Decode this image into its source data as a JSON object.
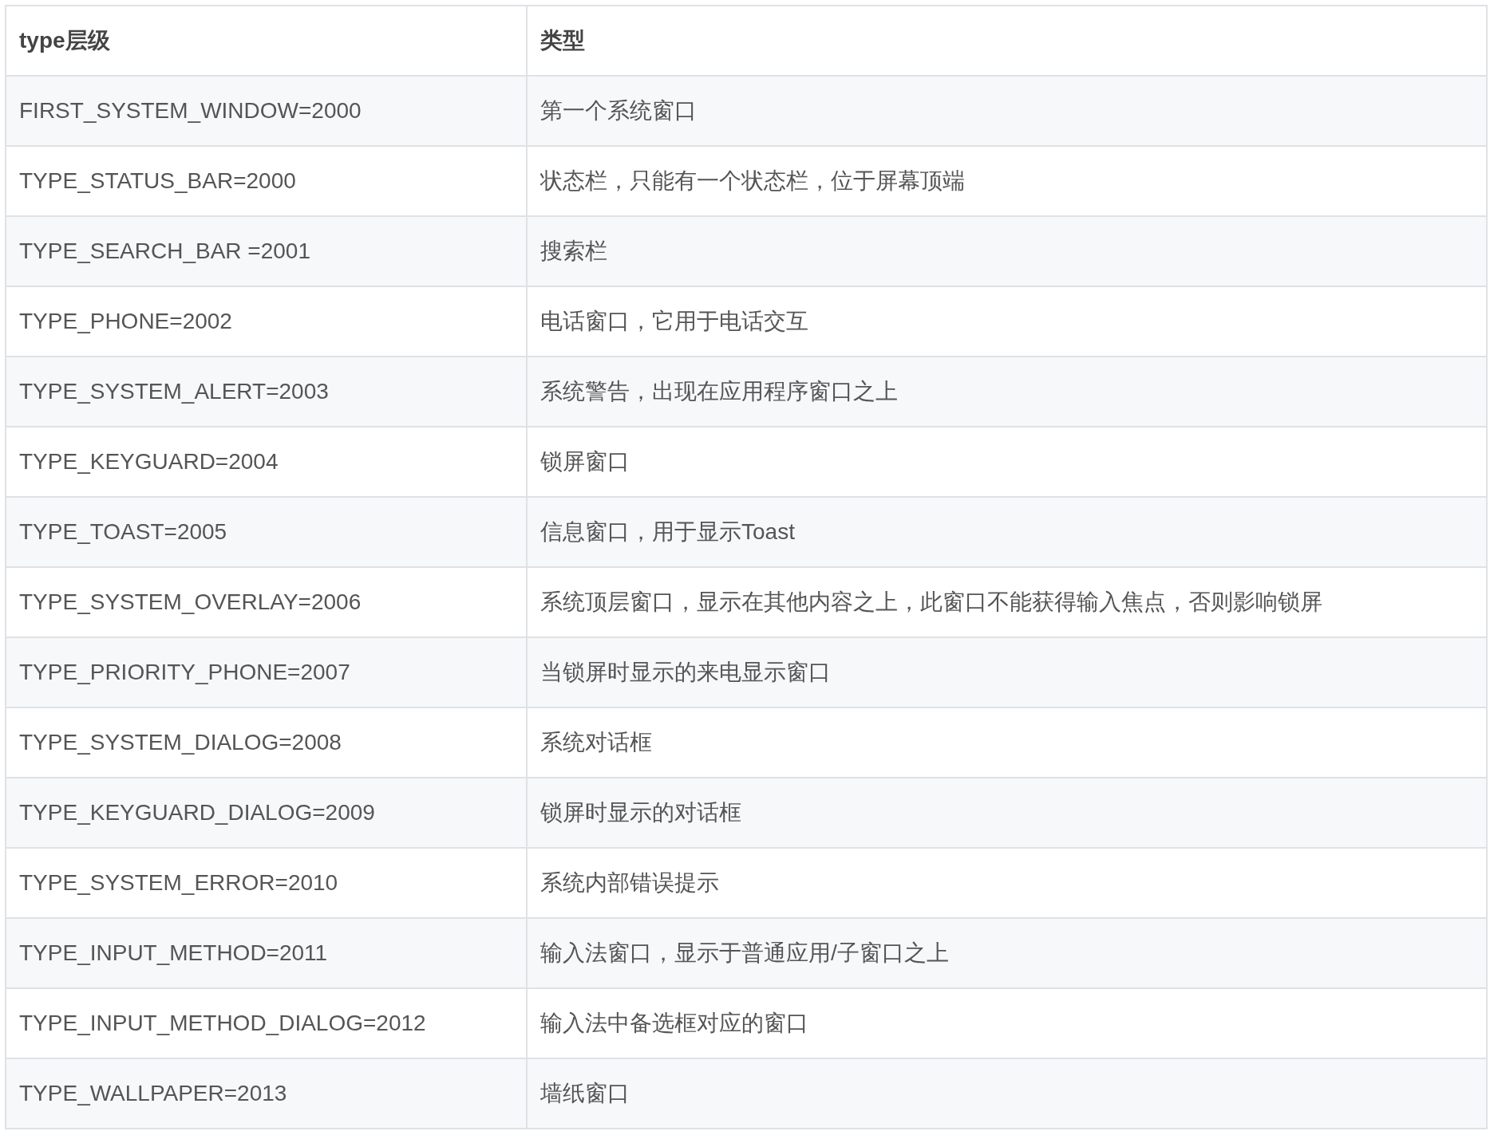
{
  "table": {
    "columns": [
      "type层级",
      "类型"
    ],
    "rows": [
      [
        "FIRST_SYSTEM_WINDOW=2000",
        "第一个系统窗口"
      ],
      [
        "TYPE_STATUS_BAR=2000",
        "状态栏，只能有一个状态栏，位于屏幕顶端"
      ],
      [
        "TYPE_SEARCH_BAR =2001",
        "搜索栏"
      ],
      [
        "TYPE_PHONE=2002",
        "电话窗口，它用于电话交互"
      ],
      [
        "TYPE_SYSTEM_ALERT=2003",
        "系统警告，出现在应用程序窗口之上"
      ],
      [
        "TYPE_KEYGUARD=2004",
        "锁屏窗口"
      ],
      [
        "TYPE_TOAST=2005",
        "信息窗口，用于显示Toast"
      ],
      [
        "TYPE_SYSTEM_OVERLAY=2006",
        "系统顶层窗口，显示在其他内容之上，此窗口不能获得输入焦点，否则影响锁屏"
      ],
      [
        "TYPE_PRIORITY_PHONE=2007",
        "当锁屏时显示的来电显示窗口"
      ],
      [
        "TYPE_SYSTEM_DIALOG=2008",
        "系统对话框"
      ],
      [
        "TYPE_KEYGUARD_DIALOG=2009",
        "锁屏时显示的对话框"
      ],
      [
        "TYPE_SYSTEM_ERROR=2010",
        "系统内部错误提示"
      ],
      [
        "TYPE_INPUT_METHOD=2011",
        "输入法窗口，显示于普通应用/子窗口之上"
      ],
      [
        "TYPE_INPUT_METHOD_DIALOG=2012",
        "输入法中备选框对应的窗口"
      ],
      [
        "TYPE_WALLPAPER=2013",
        "墙纸窗口"
      ]
    ]
  }
}
